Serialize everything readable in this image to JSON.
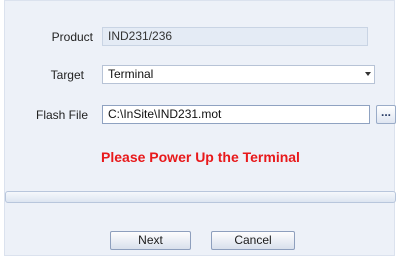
{
  "form": {
    "product": {
      "label": "Product",
      "value": "IND231/236"
    },
    "target": {
      "label": "Target",
      "value": "Terminal"
    },
    "flash_file": {
      "label": "Flash File",
      "value": "C:\\InSite\\IND231.mot",
      "browse_label": "..."
    }
  },
  "status": {
    "message": "Please Power Up the Terminal",
    "color": "#e8191b"
  },
  "progress": {
    "fraction": 0
  },
  "buttons": {
    "next": "Next",
    "cancel": "Cancel"
  }
}
